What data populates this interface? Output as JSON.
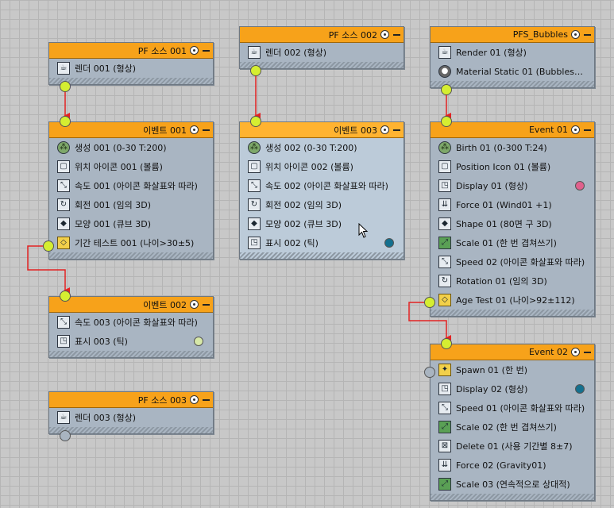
{
  "colors": {
    "wire": "#e32222",
    "port_active": "#d5ee31",
    "port_inactive": "#a9b4c0",
    "header": "#f7a21a"
  },
  "nodes": {
    "pfsource001": {
      "title": "PF 소스 001",
      "ops": [
        {
          "label": "렌더 001 (형상)",
          "icon": "teapot-icon"
        }
      ]
    },
    "pfsource002": {
      "title": "PF 소스 002",
      "ops": [
        {
          "label": "렌더 002 (형상)",
          "icon": "teapot-icon"
        }
      ]
    },
    "pfsource003": {
      "title": "PF 소스 003",
      "ops": [
        {
          "label": "렌더 003 (형상)",
          "icon": "teapot-icon"
        }
      ]
    },
    "pfsbubbles": {
      "title": "PFS_Bubbles",
      "ops": [
        {
          "label": "Render 01 (형상)",
          "icon": "teapot-icon"
        },
        {
          "label": "Material Static 01 (BubblesShad…",
          "icon": "material-sphere-icon"
        }
      ]
    },
    "event001": {
      "title": "이벤트 001",
      "ops": [
        {
          "label": "생성 001 (0-30 T:200)",
          "icon": "birth-icon"
        },
        {
          "label": "위치 아이콘 001 (볼륨)",
          "icon": "position-icon"
        },
        {
          "label": "속도 001 (아이콘 화살표와 따라)",
          "icon": "speed-icon"
        },
        {
          "label": "회전 001 (임의 3D)",
          "icon": "rotation-icon"
        },
        {
          "label": "모양 001 (큐브 3D)",
          "icon": "shape-icon"
        },
        {
          "label": "기간 테스트 001 (나이>30±5)",
          "icon": "age-test-icon"
        }
      ]
    },
    "event002": {
      "title": "이벤트 002",
      "ops": [
        {
          "label": "속도 003 (아이콘 화살표와 따라)",
          "icon": "speed-icon"
        },
        {
          "label": "표시 003 (틱)",
          "icon": "display-icon",
          "dot": "#d7e8a8"
        }
      ]
    },
    "event003": {
      "title": "이벤트 003",
      "ops": [
        {
          "label": "생성 002 (0-30 T:200)",
          "icon": "birth-icon"
        },
        {
          "label": "위치 아이콘 002 (볼륨)",
          "icon": "position-icon"
        },
        {
          "label": "속도 002 (아이콘 화살표와 따라)",
          "icon": "speed-icon"
        },
        {
          "label": "회전 002 (임의 3D)",
          "icon": "rotation-icon"
        },
        {
          "label": "모양 002 (큐브 3D)",
          "icon": "shape-icon"
        },
        {
          "label": "표시 002 (틱)",
          "icon": "display-icon",
          "dot": "#14708f"
        }
      ]
    },
    "event01": {
      "title": "Event 01",
      "ops": [
        {
          "label": "Birth 01 (0-300 T:24)",
          "icon": "birth-icon"
        },
        {
          "label": "Position Icon 01 (볼륨)",
          "icon": "position-icon"
        },
        {
          "label": "Display 01 (형상)",
          "icon": "display-icon",
          "dot": "#e0608c"
        },
        {
          "label": "Force 01 (Wind01 +1)",
          "icon": "force-icon"
        },
        {
          "label": "Shape 01 (80면 구 3D)",
          "icon": "shape-icon"
        },
        {
          "label": "Scale 01 (한 번 겹쳐쓰기)",
          "icon": "scale-icon"
        },
        {
          "label": "Speed 02 (아이콘 화살표와 따라)",
          "icon": "speed-icon"
        },
        {
          "label": "Rotation 01 (임의 3D)",
          "icon": "rotation-icon"
        },
        {
          "label": "Age Test 01 (나이>92±112)",
          "icon": "age-test-icon"
        }
      ]
    },
    "event02": {
      "title": "Event 02",
      "ops": [
        {
          "label": "Spawn 01 (한 번)",
          "icon": "spawn-icon"
        },
        {
          "label": "Display 02 (형상)",
          "icon": "display-icon",
          "dot": "#14708f"
        },
        {
          "label": "Speed 01 (아이콘 화살표와 따라)",
          "icon": "speed-icon"
        },
        {
          "label": "Scale 02 (한 번 겹쳐쓰기)",
          "icon": "scale-icon"
        },
        {
          "label": "Delete 01 (사용 기간별 8±7)",
          "icon": "delete-icon"
        },
        {
          "label": "Force 02 (Gravity01)",
          "icon": "force-icon"
        },
        {
          "label": "Scale 03 (연속적으로 상대적)",
          "icon": "scale-icon"
        }
      ]
    }
  }
}
